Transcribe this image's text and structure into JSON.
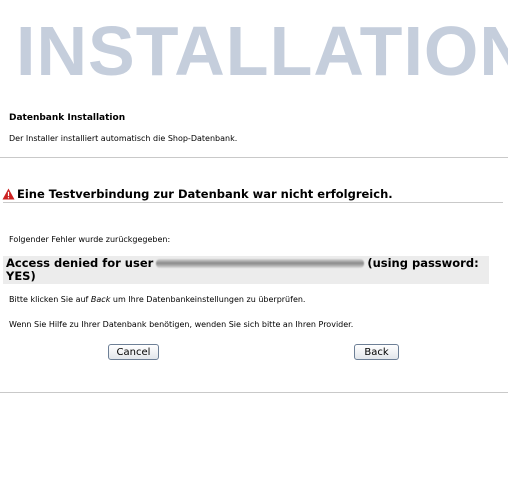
{
  "header": {
    "banner": "INSTALLATION"
  },
  "intro": {
    "title": "Datenbank Installation",
    "description": "Der Installer installiert automatisch die Shop-Datenbank."
  },
  "warning": {
    "icon": "warning-icon",
    "icon_color": "#cc2222",
    "message": "Eine Testverbindung zur Datenbank war nicht erfolgreich."
  },
  "error": {
    "label": "Folgender Fehler wurde zurückgegeben:",
    "line1_prefix": "Access denied for user",
    "line1_suffix": "(using password:",
    "line2": "YES)"
  },
  "hints": {
    "back_prefix": "Bitte klicken Sie auf ",
    "back_word": "Back",
    "back_suffix": " um Ihre Datenbankeinstellungen zu überprüfen.",
    "provider": "Wenn Sie Hilfe zu Ihrer Datenbank benötigen, wenden Sie sich bitte an Ihren Provider."
  },
  "buttons": {
    "cancel": "Cancel",
    "back": "Back"
  },
  "colors": {
    "banner": "#c5cedc",
    "error_box": "#ececec",
    "divider": "#c9c9c9"
  }
}
